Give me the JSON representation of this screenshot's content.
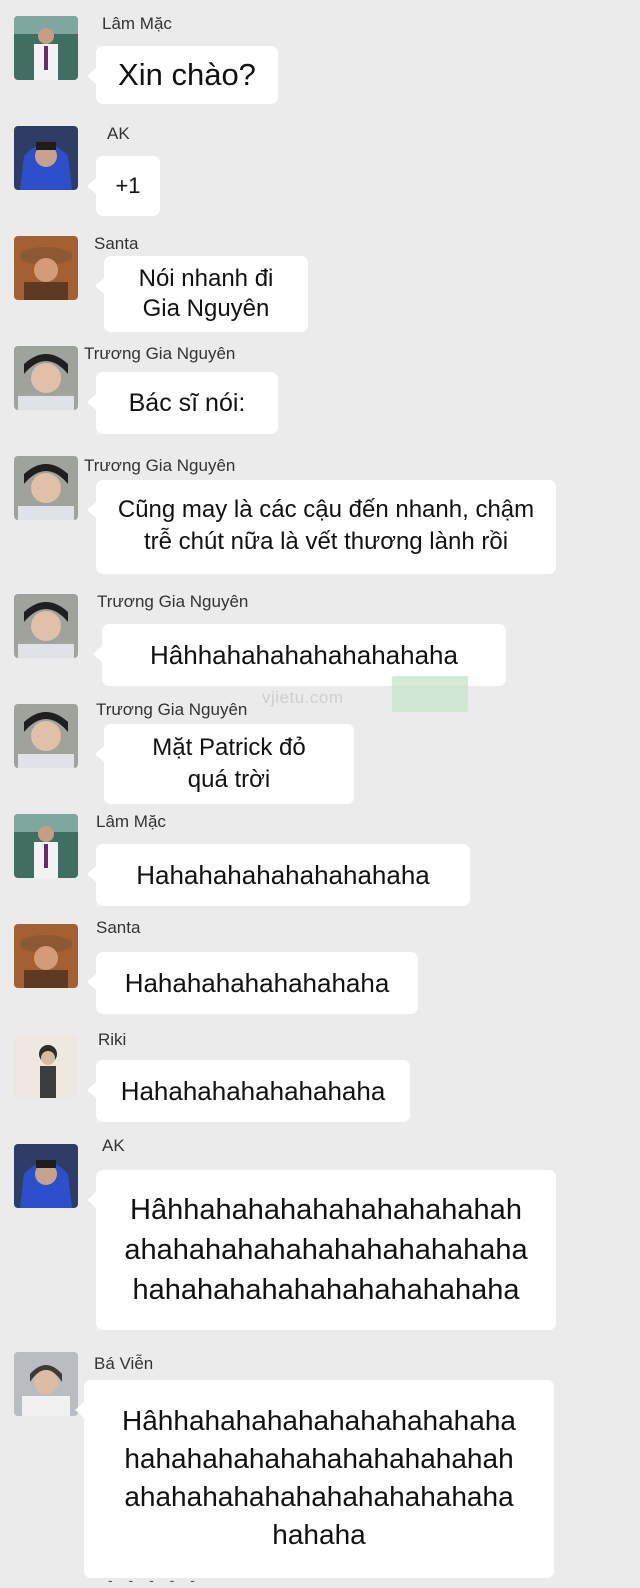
{
  "watermark": "vjietu.com",
  "footer_fragment": "- - - - -",
  "messages": [
    {
      "sender": "Lâm Mặc",
      "avatar": "school-uniform-avatar-icon",
      "text": "Xin chào?"
    },
    {
      "sender": "AK",
      "avatar": "blue-hoodie-avatar-icon",
      "text": "+1"
    },
    {
      "sender": "Santa",
      "avatar": "hat-avatar-icon",
      "text": "Nói nhanh đi\nGia Nguyên"
    },
    {
      "sender": "Trương Gia Nguyên",
      "avatar": "selfie-avatar-icon",
      "text": "Bác sĩ nói:"
    },
    {
      "sender": "Trương Gia Nguyên",
      "avatar": "selfie-avatar-icon",
      "text": "Cũng may là các cậu đến nhanh, chậm\ntrễ chút nữa là vết thương lành rồi"
    },
    {
      "sender": "Trương Gia Nguyên",
      "avatar": "selfie-avatar-icon",
      "text": "Hâhhahahahahahahahaha"
    },
    {
      "sender": "Trương Gia Nguyên",
      "avatar": "selfie-avatar-icon",
      "text": "Mặt Patrick đỏ\nquá trời"
    },
    {
      "sender": "Lâm Mặc",
      "avatar": "school-uniform-avatar-icon",
      "text": "Hahahahahahahahahaha"
    },
    {
      "sender": "Santa",
      "avatar": "hat-avatar-icon",
      "text": "Hahahahahahahahaha"
    },
    {
      "sender": "Riki",
      "avatar": "profile-avatar-icon",
      "text": "Hahahahahahahahaha"
    },
    {
      "sender": "AK",
      "avatar": "blue-hoodie-avatar-icon",
      "text": "Hâhhahahahahahahahahahah\nahahahahahahahahahahahaha\nhahahahahahahahahahahaha"
    },
    {
      "sender": "Bá Viễn",
      "avatar": "jacket-avatar-icon",
      "text": "Hâhhahahahahahahahahahaha\nhahahahahahahahahahahahah\nahahahahahahahahahahahaha\nhahaha"
    }
  ]
}
